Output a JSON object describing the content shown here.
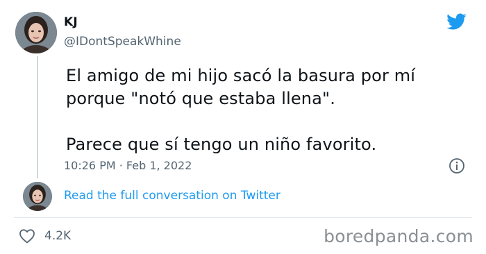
{
  "tweet": {
    "author_name": "KJ",
    "author_handle": "@IDontSpeakWhine",
    "text": "El amigo de mi hijo sacó la basura por mí\nporque \"notó que estaba llena\".\n\nParece que sí tengo un niño favorito.",
    "timestamp": "10:26 PM · Feb 1, 2022",
    "read_more_label": "Read the full conversation on Twitter",
    "like_count": "4.2K"
  },
  "watermark": "boredpanda.com",
  "icons": {
    "brand": "twitter-bird-icon",
    "info": "info-icon",
    "like": "heart-icon"
  },
  "colors": {
    "accent": "#1d9bf0",
    "secondary_text": "#536471"
  }
}
